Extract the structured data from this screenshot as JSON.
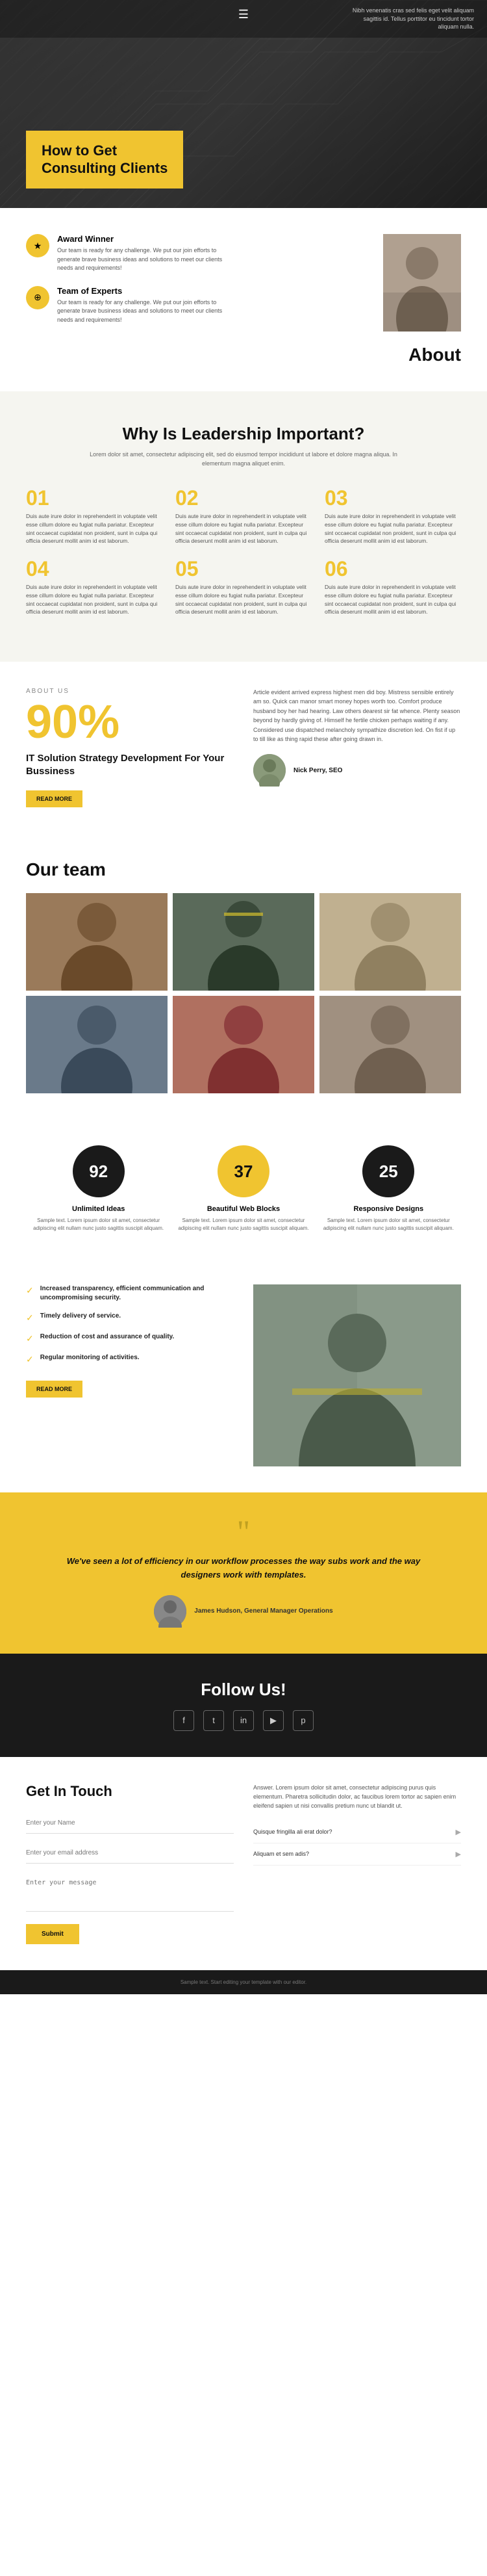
{
  "hero": {
    "title_line1": "How to Get",
    "title_line2": "Consulting Clients",
    "top_text": "Nibh venenatis cras sed felis eget velit aliquam sagittis id. Tellus porttitor eu tincidunt tortor aliquam nulla."
  },
  "about": {
    "title": "About",
    "award_title": "Award Winner",
    "award_desc": "Our team is ready for any challenge. We put our join efforts to generate brave business ideas and solutions to meet our clients needs and requirements!",
    "experts_title": "Team of Experts",
    "experts_desc": "Our team is ready for any challenge. We put our join efforts to generate brave business ideas and solutions to meet our clients needs and requirements!"
  },
  "leadership": {
    "title": "Why Is Leadership Important?",
    "subtitle": "Lorem dolor sit amet, consectetur adipiscing elit, sed do eiusmod tempor incididunt ut labore et dolore magna aliqua. In elementum magna aliquet enim.",
    "items": [
      {
        "num": "01",
        "text": "Duis aute irure dolor in reprehenderit in voluptate velit esse cillum dolore eu fugiat nulla pariatur. Excepteur sint occaecat cupidatat non proident, sunt in culpa qui officia deserunt mollit anim id est laborum."
      },
      {
        "num": "02",
        "text": "Duis aute irure dolor in reprehenderit in voluptate velit esse cillum dolore eu fugiat nulla pariatur. Excepteur sint occaecat cupidatat non proident, sunt in culpa qui officia deserunt mollit anim id est laborum."
      },
      {
        "num": "03",
        "text": "Duis aute irure dolor in reprehenderit in voluptate velit esse cillum dolore eu fugiat nulla pariatur. Excepteur sint occaecat cupidatat non proident, sunt in culpa qui officia deserunt mollit anim id est laborum."
      },
      {
        "num": "04",
        "text": "Duis aute irure dolor in reprehenderit in voluptate velit esse cillum dolore eu fugiat nulla pariatur. Excepteur sint occaecat cupidatat non proident, sunt in culpa qui officia deserunt mollit anim id est laborum."
      },
      {
        "num": "05",
        "text": "Duis aute irure dolor in reprehenderit in voluptate velit esse cillum dolore eu fugiat nulla pariatur. Excepteur sint occaecat cupidatat non proident, sunt in culpa qui officia deserunt mollit anim id est laborum."
      },
      {
        "num": "06",
        "text": "Duis aute irure dolor in reprehenderit in voluptate velit esse cillum dolore eu fugiat nulla pariatur. Excepteur sint occaecat cupidatat non proident, sunt in culpa qui officia deserunt mollit anim id est laborum."
      }
    ]
  },
  "about_us": {
    "label": "ABOUT US",
    "percent": "90%",
    "heading": "IT Solution Strategy Development For Your Bussiness",
    "read_more": "READ MORE",
    "right_text_1": "Article evident arrived express highest men did boy. Mistress sensible entirely am so. Quick can manor smart money hopes worth too. Comfort produce husband boy her had hearing. Law others dearest sir fat whence. Plenty season beyond by hardly giving of. Himself he fertile chicken perhaps waiting if any. Considered use dispatched melancholy sympathize discretion led. On fist if up to till like as thing rapid these after going drawn in.",
    "ceo_name": "Nick Perry, SEO",
    "ceo_title": ""
  },
  "team": {
    "title": "Our team"
  },
  "stats": [
    {
      "num": "92",
      "title": "Unlimited Ideas",
      "desc": "Sample text. Lorem ipsum dolor sit amet, consectetur adipiscing elit nullam nunc justo sagittis suscipit aliquam.",
      "style": "dark"
    },
    {
      "num": "37",
      "title": "Beautiful Web Blocks",
      "desc": "Sample text. Lorem ipsum dolor sit amet, consectetur adipiscing elit nullam nunc justo sagittis suscipit aliquam.",
      "style": "yellow"
    },
    {
      "num": "25",
      "title": "Responsive Designs",
      "desc": "Sample text. Lorem ipsum dolor sit amet, consectetur adipiscing elit nullam nunc justo sagittis suscipit aliquam.",
      "style": "dark"
    }
  ],
  "features": {
    "items": [
      "Increased transparency, efficient communication and uncompromising security.",
      "Timely delivery of service.",
      "Reduction of cost and assurance of quality.",
      "Regular monitoring of activities."
    ],
    "read_more": "READ MORE"
  },
  "quote": {
    "text": "We've seen a lot of efficiency in our workflow processes the way subs work and the way designers work with templates.",
    "person_name": "James Hudson, General Manager Operations",
    "person_title": ""
  },
  "follow": {
    "title": "Follow Us!",
    "social": [
      "f",
      "t",
      "in",
      "y",
      "p"
    ]
  },
  "contact": {
    "title": "Get In Touch",
    "name_placeholder": "Enter your Name",
    "email_placeholder": "Enter your email address",
    "message_placeholder": "Enter your message",
    "submit_label": "Submit",
    "right_text": "Answer. Lorem ipsum dolor sit amet, consectetur adipiscing purus quis elementum. Pharetra sollicitudin dolor, ac faucibus lorem tortor ac sapien enim eleifend sapien ut nisi convallis pretium nunc ut blandit ut.",
    "faq_items": [
      "Quisque fringilla ali erat dolor?",
      "Aliquam et sem adis?"
    ]
  },
  "footer": {
    "text": "Sample text. Start editing your template with our editor."
  }
}
